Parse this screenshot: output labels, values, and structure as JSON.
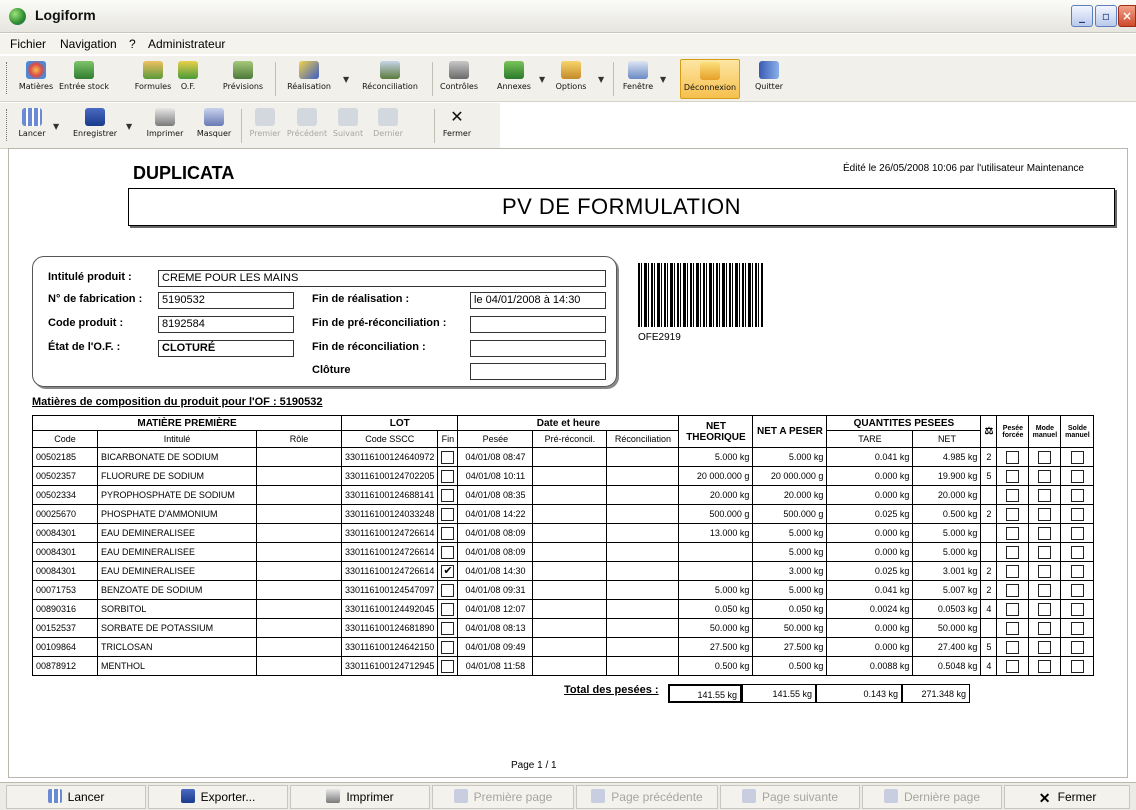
{
  "window": {
    "title": "Logiform",
    "min": "_",
    "max": "▫",
    "close": "×"
  },
  "menu": [
    "Fichier",
    "Navigation",
    "?",
    "Administrateur"
  ],
  "toolbar1": [
    "Matières",
    "Entrée stock",
    "Formules",
    "O.F.",
    "Prévisions",
    "Réalisation",
    "Réconciliation",
    "Contrôles",
    "Annexes",
    "Options",
    "Fenêtre",
    "Déconnexion",
    "Quitter"
  ],
  "toolbar2": [
    "Lancer",
    "Enregistrer",
    "Imprimer",
    "Masquer",
    "Premier",
    "Précédent",
    "Suivant",
    "Dernier",
    "Fermer"
  ],
  "doc": {
    "duplicata": "DUPLICATA",
    "edited": "Édité le 26/05/2008 10:06 par l'utilisateur Maintenance",
    "title": "PV DE FORMULATION",
    "info": {
      "intitule_label": "Intitulé produit :",
      "intitule": "CREME POUR LES MAINS",
      "fab_label": "N° de fabrication :",
      "fab": "5190532",
      "code_label": "Code produit :",
      "code": "8192584",
      "etat_label": "État de l'O.F. :",
      "etat": "CLOTURÉ",
      "finreal_label": "Fin de réalisation :",
      "finreal": "le 04/01/2008 à 14:30",
      "finprerec_label": "Fin de pré-réconciliation :",
      "finprerec": "",
      "finrec_label": "Fin de réconciliation :",
      "finrec": "",
      "cloture_label": "Clôture",
      "cloture": ""
    },
    "barcode_label": "OFE2919",
    "materials_title": "Matières de composition du produit pour l'OF : 5190532",
    "headers": {
      "matiere": "MATIÈRE PREMIÈRE",
      "lot": "LOT",
      "date": "Date et heure",
      "net_theo": "NET THEORIQUE",
      "net_peser": "NET A PESER",
      "quantites": "QUANTITES PESEES",
      "code": "Code",
      "intitule": "Intitulé",
      "role": "Rôle",
      "sscc": "Code SSCC",
      "fin": "Fin",
      "pesee": "Pesée",
      "prerec": "Pré-réconcil.",
      "rec": "Réconciliation",
      "tare": "TARE",
      "net": "NET",
      "balance": "⚖",
      "pesee_forcee": "Pesée forcée",
      "mode_manuel": "Mode manuel",
      "solde_manuel": "Solde manuel"
    },
    "rows": [
      {
        "code": "00502185",
        "intitule": "BICARBONATE DE SODIUM",
        "sscc": "330116100124640972",
        "fin": "",
        "pesee": "04/01/08 08:47",
        "theo": "5.000 kg",
        "peser": "5.000 kg",
        "tare": "0.041 kg",
        "net": "4.985 kg",
        "bal": "2"
      },
      {
        "code": "00502357",
        "intitule": "FLUORURE DE SODIUM",
        "sscc": "330116100124702205",
        "fin": "",
        "pesee": "04/01/08 10:11",
        "theo": "20 000.000 g",
        "peser": "20 000.000 g",
        "tare": "0.000 kg",
        "net": "19.900 kg",
        "bal": "5"
      },
      {
        "code": "00502334",
        "intitule": "PYROPHOSPHATE DE SODIUM",
        "sscc": "330116100124688141",
        "fin": "",
        "pesee": "04/01/08 08:35",
        "theo": "20.000 kg",
        "peser": "20.000 kg",
        "tare": "0.000 kg",
        "net": "20.000 kg",
        "bal": ""
      },
      {
        "code": "00025670",
        "intitule": "PHOSPHATE D'AMMONIUM",
        "sscc": "330116100124033248",
        "fin": "",
        "pesee": "04/01/08 14:22",
        "theo": "500.000 g",
        "peser": "500.000 g",
        "tare": "0.025 kg",
        "net": "0.500 kg",
        "bal": "2"
      },
      {
        "code": "00084301",
        "intitule": "EAU DEMINERALISEE",
        "sscc": "330116100124726614",
        "fin": "",
        "pesee": "04/01/08 08:09",
        "theo": "13.000 kg",
        "peser": "5.000 kg",
        "tare": "0.000 kg",
        "net": "5.000 kg",
        "bal": ""
      },
      {
        "code": "00084301",
        "intitule": "EAU DEMINERALISEE",
        "sscc": "330116100124726614",
        "fin": "",
        "pesee": "04/01/08 08:09",
        "theo": "",
        "peser": "5.000 kg",
        "tare": "0.000 kg",
        "net": "5.000 kg",
        "bal": ""
      },
      {
        "code": "00084301",
        "intitule": "EAU DEMINERALISEE",
        "sscc": "330116100124726614",
        "fin": "✔",
        "pesee": "04/01/08 14:30",
        "theo": "",
        "peser": "3.000 kg",
        "tare": "0.025 kg",
        "net": "3.001 kg",
        "bal": "2"
      },
      {
        "code": "00071753",
        "intitule": "BENZOATE DE SODIUM",
        "sscc": "330116100124547097",
        "fin": "",
        "pesee": "04/01/08 09:31",
        "theo": "5.000 kg",
        "peser": "5.000 kg",
        "tare": "0.041 kg",
        "net": "5.007 kg",
        "bal": "2"
      },
      {
        "code": "00890316",
        "intitule": "SORBITOL",
        "sscc": "330116100124492045",
        "fin": "",
        "pesee": "04/01/08 12:07",
        "theo": "0.050 kg",
        "peser": "0.050 kg",
        "tare": "0.0024 kg",
        "net": "0.0503 kg",
        "bal": "4"
      },
      {
        "code": "00152537",
        "intitule": "SORBATE DE POTASSIUM",
        "sscc": "330116100124681890",
        "fin": "",
        "pesee": "04/01/08 08:13",
        "theo": "50.000 kg",
        "peser": "50.000 kg",
        "tare": "0.000 kg",
        "net": "50.000 kg",
        "bal": ""
      },
      {
        "code": "00109864",
        "intitule": "TRICLOSAN",
        "sscc": "330116100124642150",
        "fin": "",
        "pesee": "04/01/08 09:49",
        "theo": "27.500 kg",
        "peser": "27.500 kg",
        "tare": "0.000 kg",
        "net": "27.400 kg",
        "bal": "5"
      },
      {
        "code": "00878912",
        "intitule": "MENTHOL",
        "sscc": "330116100124712945",
        "fin": "",
        "pesee": "04/01/08 11:58",
        "theo": "0.500 kg",
        "peser": "0.500 kg",
        "tare": "0.0088 kg",
        "net": "0.5048 kg",
        "bal": "4"
      }
    ],
    "total_label": "Total des pesées :",
    "totals": {
      "theo": "141.55 kg",
      "peser": "141.55 kg",
      "tare": "0.143 kg",
      "net": "271.348 kg"
    },
    "page": "Page 1 / 1"
  },
  "bottom": [
    "Lancer",
    "Exporter...",
    "Imprimer",
    "Première page",
    "Page précédente",
    "Page suivante",
    "Dernière page",
    "Fermer"
  ]
}
